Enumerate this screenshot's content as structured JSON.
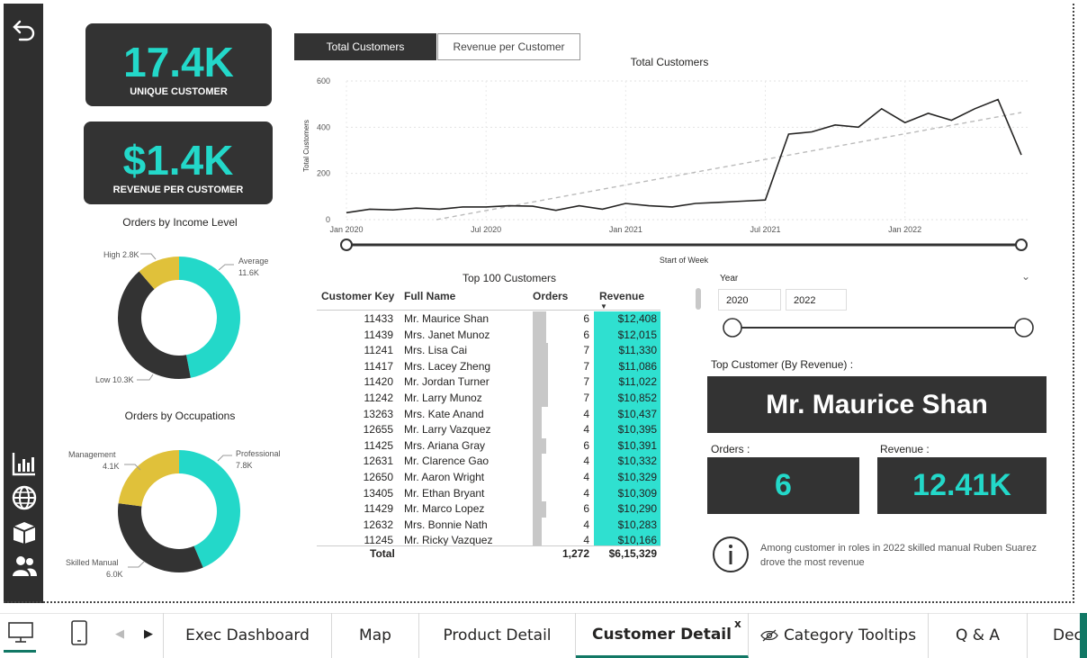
{
  "kpis": {
    "unique_customers": {
      "value": "17.4K",
      "label": "UNIQUE CUSTOMER"
    },
    "revenue_per_customer": {
      "value": "$1.4K",
      "label": "REVENUE PER CUSTOMER"
    }
  },
  "income_chart": {
    "title": "Orders by Income Level",
    "labels": {
      "high": "High 2.8K",
      "average_name": "Average",
      "average_value": "11.6K",
      "low": "Low 10.3K"
    }
  },
  "occupation_chart": {
    "title": "Orders by Occupations",
    "labels": {
      "management_name": "Management",
      "management_value": "4.1K",
      "professional_name": "Professional",
      "professional_value": "7.8K",
      "skilled_name": "Skilled Manual",
      "skilled_value": "6.0K"
    }
  },
  "chart_tabs": {
    "total_customers": "Total Customers",
    "revenue_per_customer": "Revenue per Customer"
  },
  "line_chart": {
    "title": "Total Customers",
    "ylabel": "Total Customers",
    "xlabel": "Start of Week",
    "x_ticks": [
      "Jan 2020",
      "Jul 2020",
      "Jan 2021",
      "Jul 2021",
      "Jan 2022"
    ],
    "y_ticks": [
      "0",
      "200",
      "400",
      "600"
    ]
  },
  "chart_data": [
    {
      "type": "pie",
      "title": "Orders by Income Level",
      "categories": [
        "Average",
        "Low",
        "High"
      ],
      "values": [
        11.6,
        10.3,
        2.8
      ],
      "colors": [
        "#23d8c9",
        "#333333",
        "#e0c13a"
      ]
    },
    {
      "type": "pie",
      "title": "Orders by Occupations",
      "categories": [
        "Professional",
        "Skilled Manual",
        "Management"
      ],
      "values": [
        7.8,
        6.0,
        4.1
      ],
      "colors": [
        "#23d8c9",
        "#333333",
        "#e0c13a"
      ]
    },
    {
      "type": "line",
      "title": "Total Customers",
      "xlabel": "Start of Week",
      "ylabel": "Total Customers",
      "ylim": [
        0,
        600
      ],
      "xlim": [
        "2020-01",
        "2022-06"
      ],
      "series": [
        {
          "name": "Total Customers",
          "x": [
            "2020-01",
            "2020-02",
            "2020-03",
            "2020-04",
            "2020-05",
            "2020-06",
            "2020-07",
            "2020-08",
            "2020-09",
            "2020-10",
            "2020-11",
            "2020-12",
            "2021-01",
            "2021-02",
            "2021-03",
            "2021-04",
            "2021-05",
            "2021-06",
            "2021-07",
            "2021-08",
            "2021-09",
            "2021-10",
            "2021-11",
            "2021-12",
            "2022-01",
            "2022-02",
            "2022-03",
            "2022-04",
            "2022-05",
            "2022-06"
          ],
          "y": [
            30,
            45,
            42,
            50,
            45,
            55,
            55,
            60,
            58,
            40,
            60,
            45,
            70,
            60,
            55,
            70,
            75,
            80,
            85,
            370,
            380,
            410,
            400,
            480,
            420,
            460,
            430,
            480,
            520,
            280
          ]
        }
      ]
    }
  ],
  "table": {
    "title": "Top 100 Customers",
    "headers": {
      "key": "Customer Key",
      "name": "Full Name",
      "orders": "Orders",
      "revenue": "Revenue"
    },
    "rows": [
      {
        "key": "11433",
        "name": "Mr. Maurice Shan",
        "orders": "6",
        "revenue": "$12,408"
      },
      {
        "key": "11439",
        "name": "Mrs. Janet Munoz",
        "orders": "6",
        "revenue": "$12,015"
      },
      {
        "key": "11241",
        "name": "Mrs. Lisa Cai",
        "orders": "7",
        "revenue": "$11,330"
      },
      {
        "key": "11417",
        "name": "Mrs. Lacey Zheng",
        "orders": "7",
        "revenue": "$11,086"
      },
      {
        "key": "11420",
        "name": "Mr. Jordan Turner",
        "orders": "7",
        "revenue": "$11,022"
      },
      {
        "key": "11242",
        "name": "Mr. Larry Munoz",
        "orders": "7",
        "revenue": "$10,852"
      },
      {
        "key": "13263",
        "name": "Mrs. Kate Anand",
        "orders": "4",
        "revenue": "$10,437"
      },
      {
        "key": "12655",
        "name": "Mr. Larry Vazquez",
        "orders": "4",
        "revenue": "$10,395"
      },
      {
        "key": "11425",
        "name": "Mrs. Ariana Gray",
        "orders": "6",
        "revenue": "$10,391"
      },
      {
        "key": "12631",
        "name": "Mr. Clarence Gao",
        "orders": "4",
        "revenue": "$10,332"
      },
      {
        "key": "12650",
        "name": "Mr. Aaron Wright",
        "orders": "4",
        "revenue": "$10,329"
      },
      {
        "key": "13405",
        "name": "Mr. Ethan Bryant",
        "orders": "4",
        "revenue": "$10,309"
      },
      {
        "key": "11429",
        "name": "Mr. Marco Lopez",
        "orders": "6",
        "revenue": "$10,290"
      },
      {
        "key": "12632",
        "name": "Mrs. Bonnie Nath",
        "orders": "4",
        "revenue": "$10,283"
      },
      {
        "key": "11245",
        "name": "Mr. Ricky Vazquez",
        "orders": "4",
        "revenue": "$10,166"
      }
    ],
    "total": {
      "label": "Total",
      "orders": "1,272",
      "revenue": "$6,15,329"
    }
  },
  "year_slicer": {
    "label": "Year",
    "from": "2020",
    "to": "2022"
  },
  "top_customer": {
    "label": "Top Customer (By Revenue) :",
    "name": "Mr. Maurice Shan",
    "orders_label": "Orders :",
    "orders": "6",
    "revenue_label": "Revenue :",
    "revenue": "12.41K"
  },
  "insight": {
    "text": "Among customer in roles in 2022 skilled manual Ruben Suarez drove the most revenue"
  },
  "page_tabs": [
    "Exec Dashboard",
    "Map",
    "Product Detail",
    "Customer Detail",
    "Category Tooltips",
    "Q & A",
    "Dec"
  ],
  "active_tab_close": "x",
  "icons": [
    "back-arrow-icon",
    "bar-chart-icon",
    "globe-icon",
    "box-icon",
    "people-icon",
    "desktop-icon",
    "phone-icon",
    "nav-prev-icon",
    "nav-next-icon",
    "hidden-eye-icon"
  ]
}
